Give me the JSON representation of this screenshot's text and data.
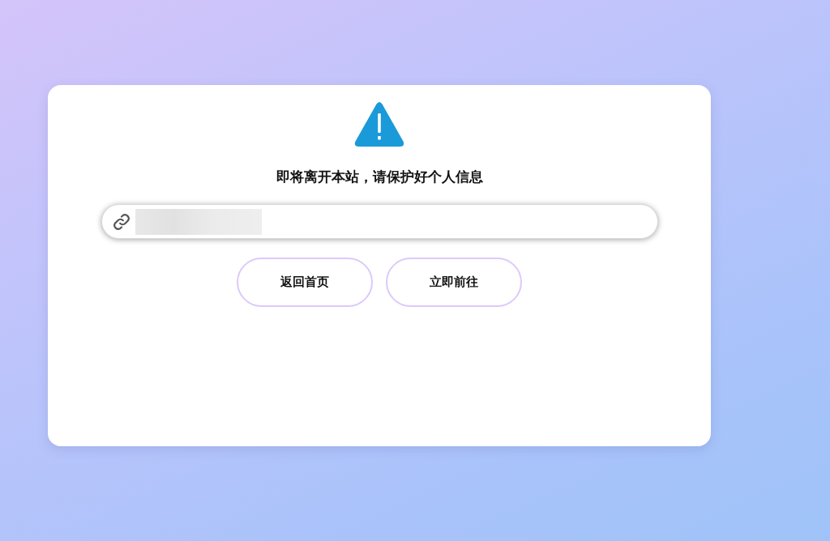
{
  "notice": {
    "title": "即将离开本站，请保护好个人信息"
  },
  "buttons": [
    {
      "label": "返回首页"
    },
    {
      "label": "立即前往"
    }
  ]
}
